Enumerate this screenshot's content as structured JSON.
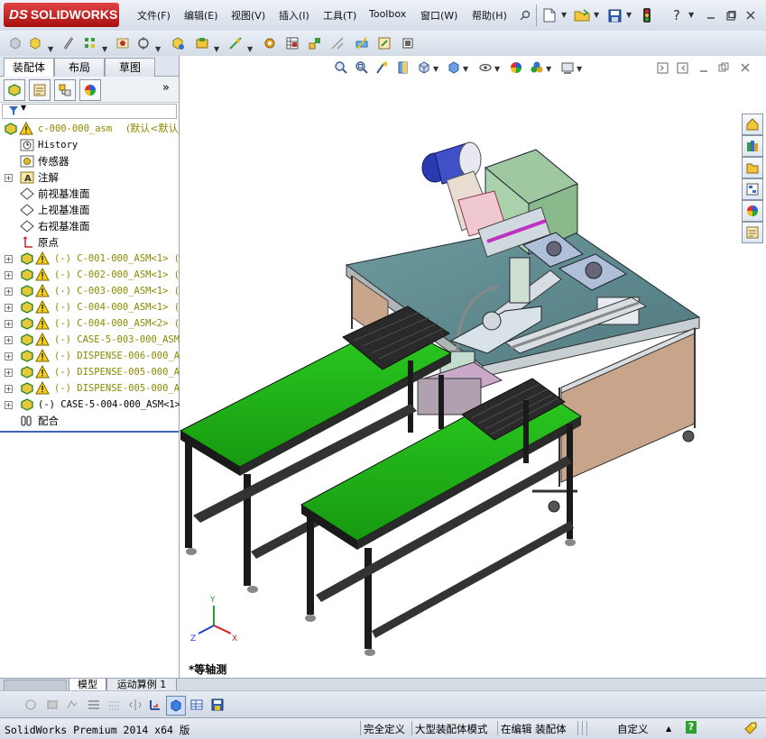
{
  "app": {
    "logo_ds": "DS",
    "logo_text": "SOLIDWORKS"
  },
  "menu": [
    "文件(F)",
    "编辑(E)",
    "视图(V)",
    "插入(I)",
    "工具(T)",
    "Toolbox",
    "窗口(W)",
    "帮助(H)"
  ],
  "left_panel": {
    "tabs": [
      "装配体",
      "布局",
      "草图"
    ],
    "expand_label": "»",
    "tree": [
      {
        "label": "c-000-000_asm",
        "suffix": "(默认<默认_",
        "style": "olive",
        "icon": "assembly-icon",
        "warn": true,
        "expand": false,
        "level": 0
      },
      {
        "label": "History",
        "style": "mono",
        "icon": "history-icon",
        "level": 1
      },
      {
        "label": "传感器",
        "icon": "sensor-icon",
        "level": 1
      },
      {
        "label": "注解",
        "icon": "annotation-icon",
        "expand": true,
        "level": 1
      },
      {
        "label": "前视基准面",
        "icon": "plane-icon",
        "level": 1
      },
      {
        "label": "上视基准面",
        "icon": "plane-icon",
        "level": 1
      },
      {
        "label": "右视基准面",
        "icon": "plane-icon",
        "level": 1
      },
      {
        "label": "原点",
        "icon": "origin-icon",
        "level": 1
      },
      {
        "label": "(-) C-001-000_ASM<1> (",
        "style": "olive",
        "icon": "subassembly-icon",
        "warn": true,
        "expand": true,
        "level": 1
      },
      {
        "label": "(-) C-002-000_ASM<1> (",
        "style": "olive",
        "icon": "subassembly-icon",
        "warn": true,
        "expand": true,
        "level": 1
      },
      {
        "label": "(-) C-003-000_ASM<1> (",
        "style": "olive",
        "icon": "subassembly-icon",
        "warn": true,
        "expand": true,
        "level": 1
      },
      {
        "label": "(-) C-004-000_ASM<1> (",
        "style": "olive",
        "icon": "subassembly-icon",
        "warn": true,
        "expand": true,
        "level": 1
      },
      {
        "label": "(-) C-004-000_ASM<2> (",
        "style": "olive",
        "icon": "subassembly-icon",
        "warn": true,
        "expand": true,
        "level": 1
      },
      {
        "label": "(-) CASE-5-003-000_ASM",
        "style": "olive",
        "icon": "subassembly-icon",
        "warn": true,
        "expand": true,
        "level": 1
      },
      {
        "label": "(-) DISPENSE-006-000_AS",
        "style": "olive",
        "icon": "subassembly-icon",
        "warn": true,
        "expand": true,
        "level": 1
      },
      {
        "label": "(-) DISPENSE-005-000_AS",
        "style": "olive",
        "icon": "subassembly-icon",
        "warn": true,
        "expand": true,
        "level": 1
      },
      {
        "label": "(-) DISPENSE-005-000_AS",
        "style": "olive",
        "icon": "subassembly-icon",
        "warn": true,
        "expand": true,
        "level": 1
      },
      {
        "label": "(-) CASE-5-004-000_ASM<1>",
        "style": "mono",
        "icon": "subassembly-icon",
        "warn": false,
        "expand": true,
        "level": 1
      },
      {
        "label": "配合",
        "icon": "mates-icon",
        "level": 1
      }
    ]
  },
  "viewport": {
    "view_label": "*等轴测"
  },
  "bottom_tabs": [
    "模型",
    "运动算例 1"
  ],
  "status": {
    "product": "SolidWorks Premium 2014 x64 版",
    "definition": "完全定义",
    "mode": "大型装配体模式",
    "editing": "在编辑 装配体",
    "units": "自定义",
    "units_caret": "▲",
    "help": "?"
  },
  "colors": {
    "accent": "#c8202a",
    "green_belt": "#22b319",
    "table_top": "#5f8a8e",
    "panel": "#c8a48a",
    "frame": "#1e1e1e"
  }
}
